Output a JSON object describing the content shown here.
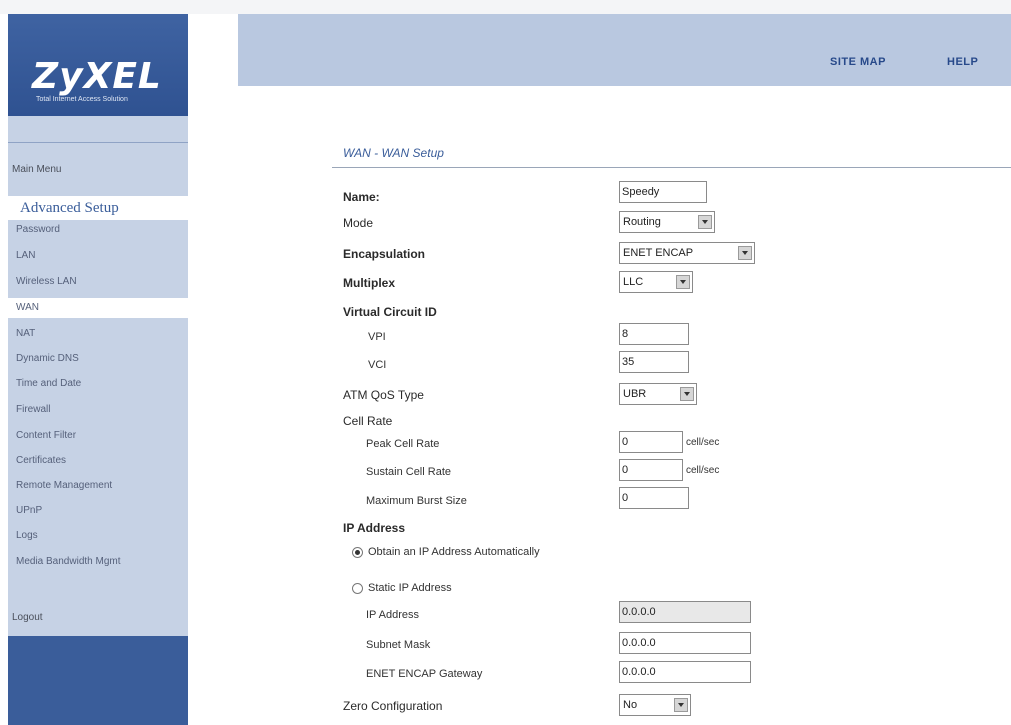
{
  "brand": {
    "logo": "ZyXEL",
    "tagline": "Total Internet Access Solution"
  },
  "header": {
    "site_map": "SITE MAP",
    "help": "HELP"
  },
  "sidebar": {
    "main_menu": "Main Menu",
    "advanced_setup": "Advanced Setup",
    "items": [
      "Password",
      "LAN",
      "Wireless LAN",
      "WAN",
      "NAT",
      "Dynamic DNS",
      "Time and Date",
      "Firewall",
      "Content Filter",
      "Certificates",
      "Remote Management",
      "UPnP",
      "Logs",
      "Media Bandwidth Mgmt"
    ],
    "active_item": "WAN",
    "logout": "Logout"
  },
  "page": {
    "title": "WAN - WAN Setup"
  },
  "form": {
    "name_label": "Name:",
    "name_value": "Speedy",
    "mode_label": "Mode",
    "mode_value": "Routing",
    "encap_label": "Encapsulation",
    "encap_value": "ENET ENCAP",
    "multiplex_label": "Multiplex",
    "multiplex_value": "LLC",
    "vc_label": "Virtual Circuit ID",
    "vpi_label": "VPI",
    "vpi_value": "8",
    "vci_label": "VCI",
    "vci_value": "35",
    "atm_label": "ATM QoS Type",
    "atm_value": "UBR",
    "cell_label": "Cell Rate",
    "peak_label": "Peak Cell Rate",
    "peak_value": "0",
    "peak_unit": "cell/sec",
    "sustain_label": "Sustain Cell Rate",
    "sustain_value": "0",
    "sustain_unit": "cell/sec",
    "burst_label": "Maximum Burst Size",
    "burst_value": "0",
    "ip_label": "IP Address",
    "obtain_label": "Obtain an IP Address Automatically",
    "static_label": "Static IP Address",
    "ipaddr_label": "IP Address",
    "ipaddr_value": "0.0.0.0",
    "mask_label": "Subnet Mask",
    "mask_value": "0.0.0.0",
    "gw_label": "ENET ENCAP Gateway",
    "gw_value": "0.0.0.0",
    "zero_label": "Zero Configuration",
    "zero_value": "No"
  }
}
